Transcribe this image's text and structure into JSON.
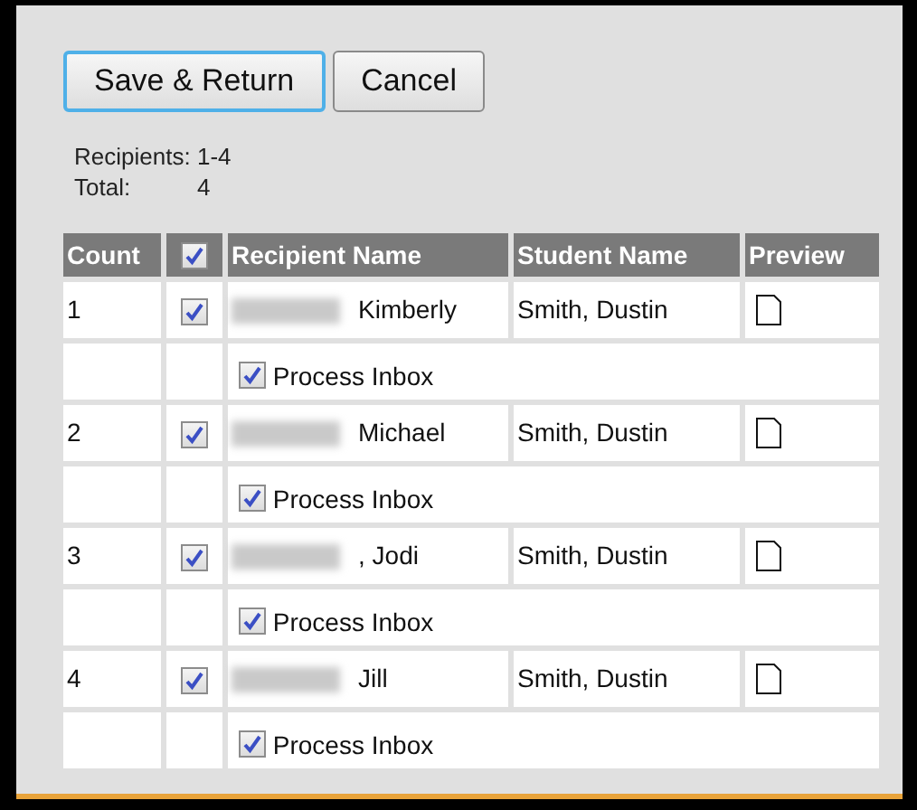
{
  "buttons": [
    {
      "label": "Save & Return",
      "selected": true
    },
    {
      "label": "Cancel",
      "selected": false
    }
  ],
  "summary": [
    {
      "label": "Recipients:",
      "value": "1-4"
    },
    {
      "label": "Total:",
      "value": "4"
    }
  ],
  "table": {
    "columns": [
      "Count",
      "Recipient Name",
      "Student Name",
      "Preview"
    ],
    "select_all": {
      "checked": true
    },
    "rows": [
      {
        "count": "1",
        "checked": true,
        "recipient_name": "Kimberly",
        "name_redacted": true,
        "student_name": "Smith, Dustin",
        "option": {
          "label": "Process Inbox",
          "checked": true
        }
      },
      {
        "count": "2",
        "checked": true,
        "recipient_name": "Michael",
        "name_redacted": true,
        "student_name": "Smith, Dustin",
        "option": {
          "label": "Process Inbox",
          "checked": true
        }
      },
      {
        "count": "3",
        "checked": true,
        "recipient_name": ", Jodi",
        "name_redacted": true,
        "student_name": "Smith, Dustin",
        "option": {
          "label": "Process Inbox",
          "checked": true
        }
      },
      {
        "count": "4",
        "checked": true,
        "recipient_name": "Jill",
        "name_redacted": true,
        "student_name": "Smith, Dustin",
        "option": {
          "label": "Process Inbox",
          "checked": true
        }
      }
    ]
  }
}
